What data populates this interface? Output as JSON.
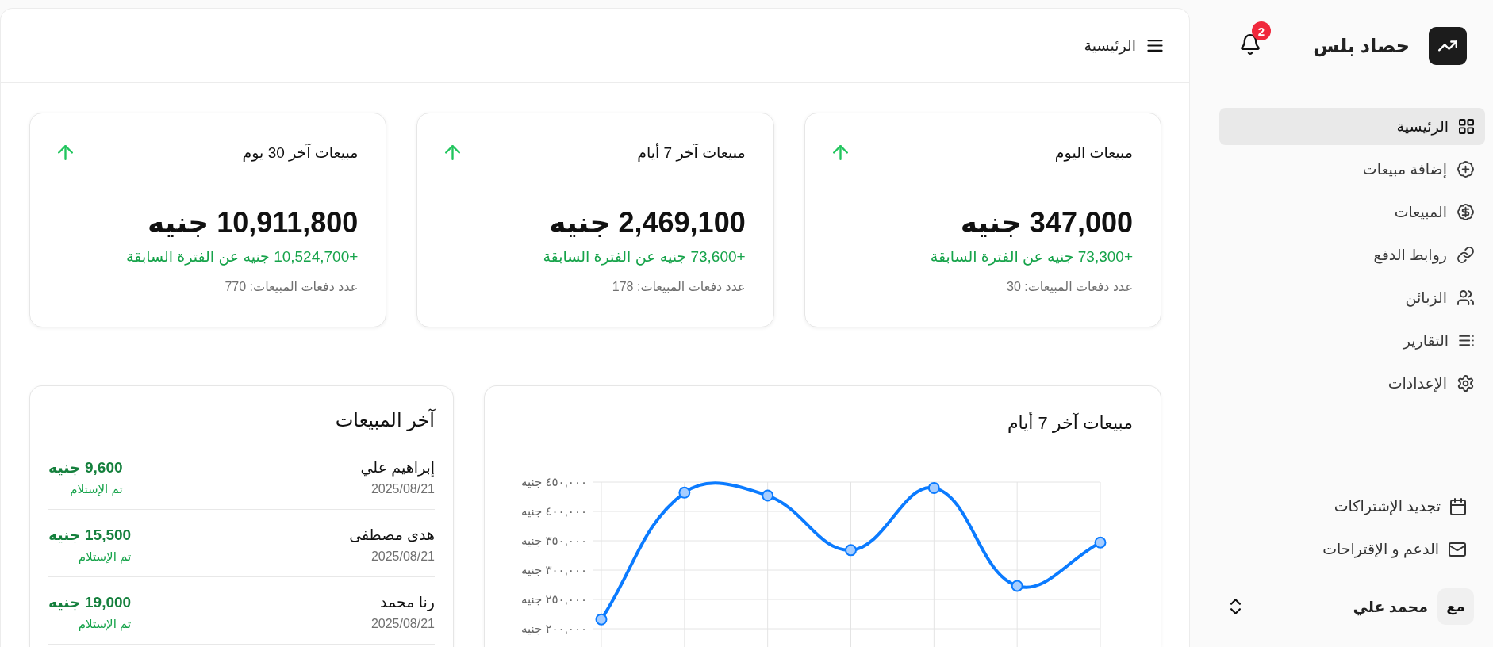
{
  "sidebar": {
    "brand": "حصاد بلس",
    "notification_count": "2",
    "nav": [
      {
        "label": "الرئيسية",
        "selected": true
      },
      {
        "label": "إضافة مبيعات",
        "selected": false
      },
      {
        "label": "المبيعات",
        "selected": false
      },
      {
        "label": "روابط الدفع",
        "selected": false
      },
      {
        "label": "الزبائن",
        "selected": false
      },
      {
        "label": "التقارير",
        "selected": false
      },
      {
        "label": "الإعدادات",
        "selected": false
      }
    ],
    "links": [
      {
        "label": "تجديد الإشتراكات"
      },
      {
        "label": "الدعم و الإقتراحات"
      }
    ],
    "user": {
      "initials": "مع",
      "name": "محمد علي"
    }
  },
  "header": {
    "title": "الرئيسية"
  },
  "stats": [
    {
      "title": "مبيعات اليوم",
      "trend_up": true,
      "value": "347,000 جنيه",
      "change": "+73,300 جنيه عن الفترة السابقة",
      "count": "عدد دفعات المبيعات: 30"
    },
    {
      "title": "مبيعات آخر 7 أيام",
      "trend_up": true,
      "value": "2,469,100 جنيه",
      "change": "+73,600 جنيه عن الفترة السابقة",
      "count": "عدد دفعات المبيعات: 178"
    },
    {
      "title": "مبيعات آخر 30 يوم",
      "trend_up": true,
      "value": "10,911,800 جنيه",
      "change": "+10,524,700 جنيه عن الفترة السابقة",
      "count": "عدد دفعات المبيعات: 770"
    }
  ],
  "chart_card": {
    "chart_data": {
      "type": "line",
      "title": "مبيعات آخر 7 أيام",
      "values": [
        216000,
        432000,
        427000,
        334000,
        440000,
        273000,
        347000
      ],
      "ylim": [
        200000,
        450000
      ],
      "yticks": [
        {
          "value": 450000,
          "label": "٤٥٠,٠٠٠ جنيه"
        },
        {
          "value": 400000,
          "label": "٤٠٠,٠٠٠ جنيه"
        },
        {
          "value": 350000,
          "label": "٣٥٠,٠٠٠ جنيه"
        },
        {
          "value": 300000,
          "label": "٣٠٠,٠٠٠ جنيه"
        },
        {
          "value": 250000,
          "label": "٢٥٠,٠٠٠ جنيه"
        },
        {
          "value": 200000,
          "label": "٢٠٠,٠٠٠ جنيه"
        }
      ],
      "grid": true,
      "marker": "circle"
    }
  },
  "recent_sales": {
    "title": "آخر المبيعات",
    "rows": [
      {
        "name": "إبراهيم علي",
        "date": "2025/08/21",
        "amount": "9,600 جنيه",
        "status": "تم الإستلام"
      },
      {
        "name": "هدى مصطفى",
        "date": "2025/08/21",
        "amount": "15,500 جنيه",
        "status": "تم الإستلام"
      },
      {
        "name": "رنا محمد",
        "date": "2025/08/21",
        "amount": "19,000 جنيه",
        "status": "تم الإستلام"
      }
    ]
  }
}
